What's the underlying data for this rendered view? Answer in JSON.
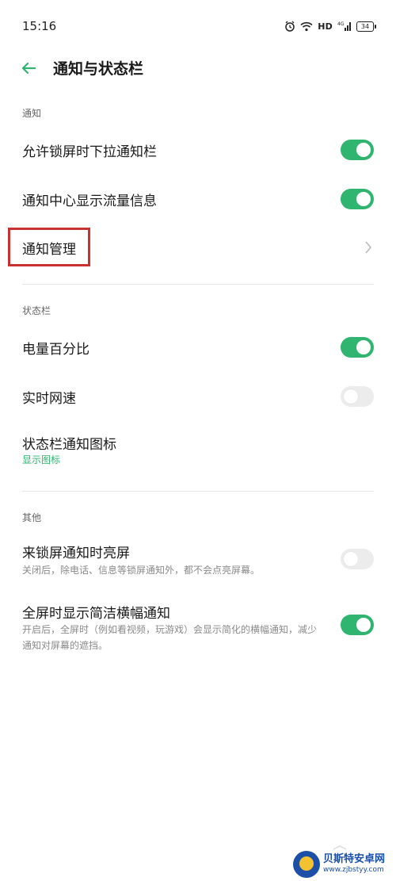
{
  "status": {
    "time": "15:16",
    "network": "HD",
    "signal": "4G",
    "battery": "34"
  },
  "header": {
    "title": "通知与状态栏"
  },
  "sections": {
    "notify": "通知",
    "statusbar": "状态栏",
    "other": "其他"
  },
  "items": {
    "lockscreen_pulldown": {
      "title": "允许锁屏时下拉通知栏",
      "on": true
    },
    "traffic_info": {
      "title": "通知中心显示流量信息",
      "on": true
    },
    "notify_manage": {
      "title": "通知管理"
    },
    "battery_percent": {
      "title": "电量百分比",
      "on": true
    },
    "net_speed": {
      "title": "实时网速",
      "on": false
    },
    "status_icons": {
      "title": "状态栏通知图标",
      "value": "显示图标"
    },
    "wake_on_notify": {
      "title": "来锁屏通知时亮屏",
      "desc": "关闭后，除电话、信息等锁屏通知外，都不会点亮屏幕。",
      "on": false
    },
    "banner_fullscreen": {
      "title": "全屏时显示简洁横幅通知",
      "desc": "开启后，全屏时（例如看视频，玩游戏）会显示简化的横幅通知，减少通知对屏幕的遮挡。",
      "on": true
    }
  },
  "colors": {
    "accent": "#2fb56f",
    "highlight": "#c83232"
  },
  "watermark": {
    "name": "贝斯特安卓网",
    "url": "www.zjbstyy.com"
  }
}
